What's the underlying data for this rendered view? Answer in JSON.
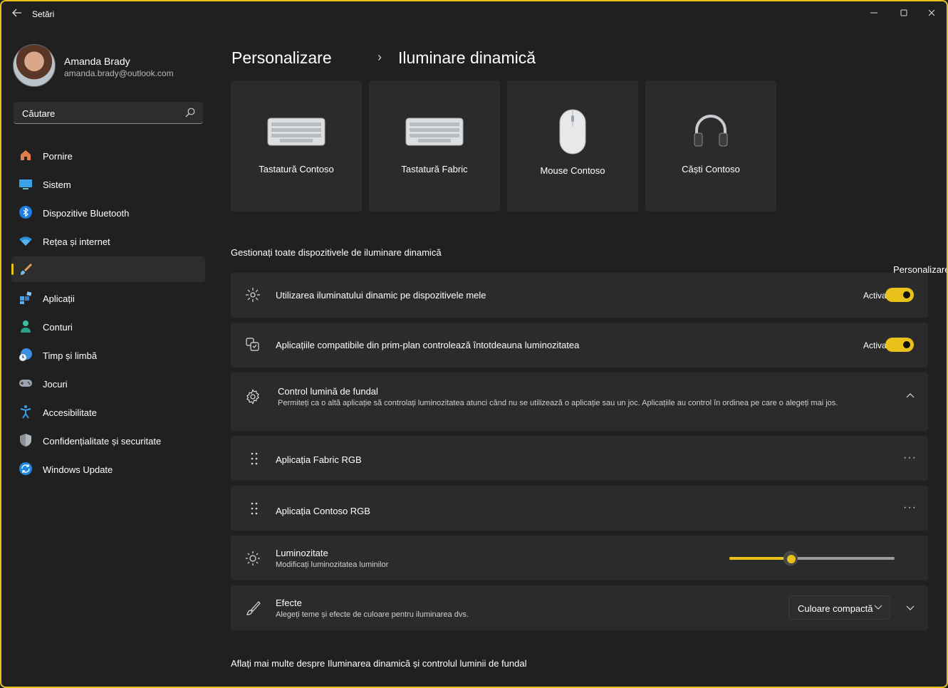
{
  "window": {
    "title": "Setări",
    "back_icon": "back-arrow-icon",
    "minimize_icon": "minimize-icon",
    "maximize_icon": "maximize-icon",
    "close_icon": "close-icon"
  },
  "accent_color": "#e8c21a",
  "profile": {
    "name": "Amanda Brady",
    "email": "amanda.brady@outlook.com"
  },
  "search": {
    "placeholder": "Căutare",
    "icon": "search-icon"
  },
  "nav": [
    {
      "label": "Pornire",
      "icon": "home-icon"
    },
    {
      "label": "Sistem",
      "icon": "system-icon"
    },
    {
      "label": "Dispozitive Bluetooth",
      "icon": "bluetooth-icon"
    },
    {
      "label": "Rețea și internet",
      "icon": "wifi-icon"
    },
    {
      "label": "",
      "icon": "paintbrush-icon",
      "active": true
    },
    {
      "label": "Aplicații",
      "icon": "apps-icon"
    },
    {
      "label": "Conturi",
      "icon": "accounts-icon"
    },
    {
      "label": "Timp și limbă",
      "icon": "time-language-icon"
    },
    {
      "label": "Jocuri",
      "icon": "gaming-icon"
    },
    {
      "label": "Accesibilitate",
      "icon": "accessibility-icon"
    },
    {
      "label": "Confidențialitate și securitate",
      "icon": "shield-icon"
    },
    {
      "label": "Windows Update",
      "icon": "windows-update-icon"
    }
  ],
  "breadcrumb": {
    "parent": "Personalizare",
    "separator": "›",
    "current": "Iluminare dinamică"
  },
  "devices": [
    {
      "label": "Tastatură Contoso",
      "icon": "keyboard-icon"
    },
    {
      "label": "Tastatură Fabric",
      "icon": "keyboard-icon"
    },
    {
      "label": "Mouse Contoso",
      "icon": "mouse-icon"
    },
    {
      "label": "Căști Contoso",
      "icon": "headphones-icon"
    }
  ],
  "section_label": "Gestionați toate dispozitivele de iluminare dinamică",
  "tooltip": "Personalizare",
  "settings": {
    "use_dynamic": {
      "title": "Utilizarea iluminatului dinamic pe dispozitivele mele",
      "state": "Activat",
      "on": true,
      "icon": "dynamic-lighting-icon"
    },
    "foreground": {
      "title": "Aplicațiile compatibile din prim-plan controlează întotdeauna luminozitatea",
      "state": "Activat",
      "on": true,
      "icon": "apps-control-icon"
    },
    "background": {
      "title": "Control lumină de fundal",
      "subtitle": "Permiteți ca o altă aplicație să controlați luminozitatea atunci când nu se utilizează o aplicație sau un joc. Aplicațiile au control în ordinea pe care o alegeți mai jos.",
      "icon": "gear-icon",
      "expanded": true
    },
    "apps": [
      {
        "title": "Aplicația Fabric RGB",
        "more": "···"
      },
      {
        "title": "Aplicația Contoso RGB",
        "more": "···"
      }
    ],
    "brightness": {
      "title": "Luminozitate",
      "subtitle": "Modificați luminozitatea luminilor",
      "value": 0.37,
      "icon": "brightness-icon"
    },
    "effects": {
      "title": "Efecte",
      "subtitle": "Alegeți teme și efecte de culoare pentru iluminarea dvs.",
      "selected": "Culoare compactă",
      "icon": "brush-icon"
    }
  },
  "learn_more": "Aflați mai multe despre Iluminarea dinamică și controlul luminii de fundal"
}
